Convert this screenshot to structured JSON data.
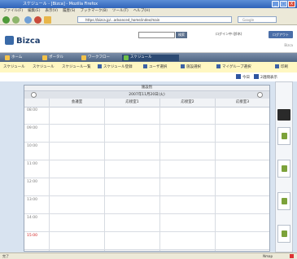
{
  "window": {
    "title": "スケジュール - [Bizca] - Mozilla Firefox",
    "buttons": [
      "_",
      "□",
      "X"
    ]
  },
  "menu": [
    "ファイル(F)",
    "編集(E)",
    "表示(V)",
    "履歴(S)",
    "ブックマーク(B)",
    "ツール(T)",
    "ヘルプ(H)"
  ],
  "nav": {
    "url": "https://bizca.jp/...advanced_home/index/main",
    "search_placeholder": "Google"
  },
  "header": {
    "brand": "Bizca",
    "search_button": "検索",
    "user": "ログイン中 (鈴木)",
    "logout_button": "ログアウト",
    "sub": "Bizca"
  },
  "tabs": [
    {
      "label": "ホーム"
    },
    {
      "label": "ポータル"
    },
    {
      "label": "ワークフロー"
    },
    {
      "label": "スケジュール"
    }
  ],
  "subbar": {
    "items": [
      "スケジュール",
      "スケジュール",
      "スケジュール一覧"
    ],
    "actions": [
      "スケジュール登録",
      "ユーザ選択",
      "施設選択",
      "マイグループ選択",
      "印刷"
    ]
  },
  "toolbar": {
    "today": "今日",
    "week": "2週間表示"
  },
  "calendar": {
    "title": "施設別",
    "date": "2007年11月20日(火)",
    "columns": [
      "",
      "会議室",
      "応接室1",
      "応接室2",
      "応接室3"
    ],
    "hours": [
      "08:00",
      "09:00",
      "10:00",
      "11:00",
      "12:00",
      "13:00",
      "14:00",
      "15:00"
    ]
  },
  "status": {
    "left": "完了",
    "right": "Nmap"
  },
  "colors": {
    "brand": "#1f3f6d",
    "tab_bg": "#4e6483",
    "subbar_bg": "#fff7c2",
    "current_hour": "#d02020"
  }
}
